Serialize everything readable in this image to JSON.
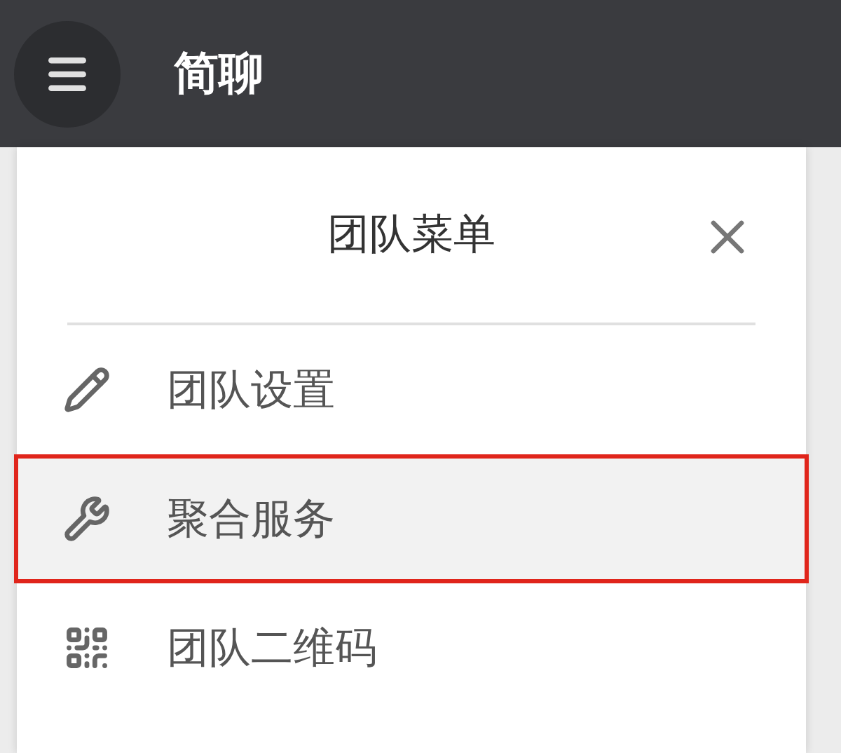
{
  "app_bar": {
    "title": "简聊"
  },
  "menu": {
    "title": "团队菜单",
    "items": [
      {
        "label": "团队设置",
        "selected": false
      },
      {
        "label": "聚合服务",
        "selected": true
      },
      {
        "label": "团队二维码",
        "selected": false
      }
    ]
  }
}
